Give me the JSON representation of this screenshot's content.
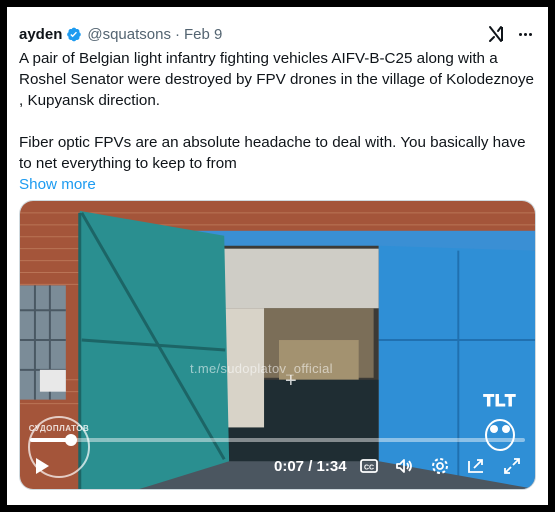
{
  "tweet": {
    "author_name": "ayden",
    "handle": "@squatsons",
    "separator": "·",
    "date": "Feb 9",
    "paragraph1": "A pair of Belgian light infantry fighting vehicles AIFV-B-C25 along with a Roshel Senator were destroyed by FPV drones in the village of Kolodeznoye , Kupyansk direction.",
    "paragraph2": "Fiber optic FPVs are an absolute headache to deal with. You basically have to net everything to keep to from",
    "show_more": "Show more"
  },
  "video": {
    "watermark": "t.me/sudoplatov_official",
    "crosshair": "+",
    "stamp_text": "СУДОПЛАТОВ",
    "channel_logo": "TLT",
    "progress": 0.083,
    "time_current": "0:07",
    "time_total": "1:34",
    "time_label": "0:07 / 1:34",
    "cc_label": "CC"
  },
  "colors": {
    "link": "#1d9bf0",
    "muted": "#536471",
    "verified": "#1d9bf0",
    "door_teal": "#2a8f90",
    "door_blue": "#2f8fd6"
  },
  "icons": [
    "verified-badge-icon",
    "grok-icon",
    "more-icon",
    "play-icon",
    "captions-icon",
    "volume-icon",
    "settings-icon",
    "pip-icon",
    "fullscreen-icon"
  ]
}
